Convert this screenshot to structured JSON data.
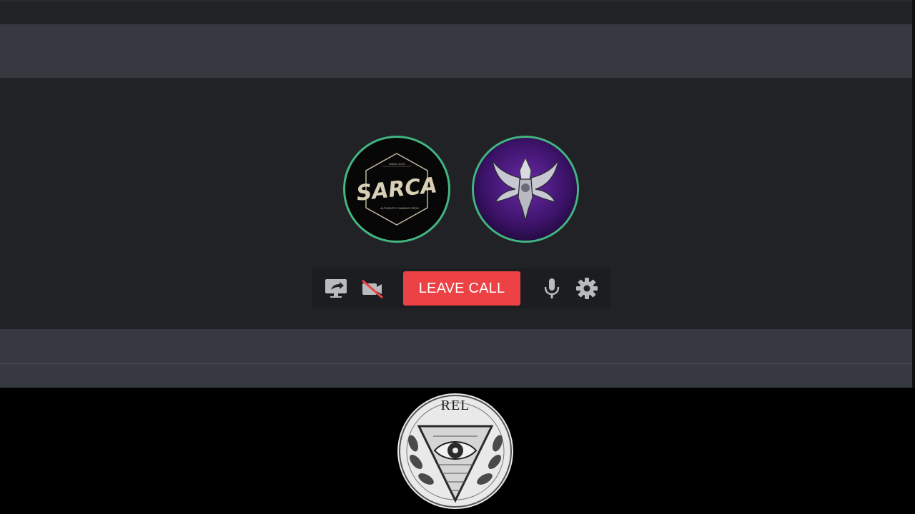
{
  "call": {
    "participants": [
      {
        "name_art": "SARCA",
        "subtitle_top": "SINCE 2019",
        "subtitle_bottom": "AUTHENTIC GAMING CREW",
        "ring_color": "#43b581"
      },
      {
        "icon": "winged-knight-logo",
        "ring_color": "#43b581"
      }
    ],
    "controls": {
      "share_screen_icon": "screen-share-icon",
      "camera_icon": "camera-off-icon",
      "leave_label": "LEAVE CALL",
      "leave_color": "#ed4245",
      "mic_icon": "microphone-icon",
      "settings_icon": "gear-icon"
    }
  },
  "watermark": {
    "text": "REL",
    "icon": "all-seeing-eye-emblem"
  },
  "colors": {
    "header": "#36393f",
    "call_background": "#202225",
    "speaking_ring": "#43b581"
  }
}
